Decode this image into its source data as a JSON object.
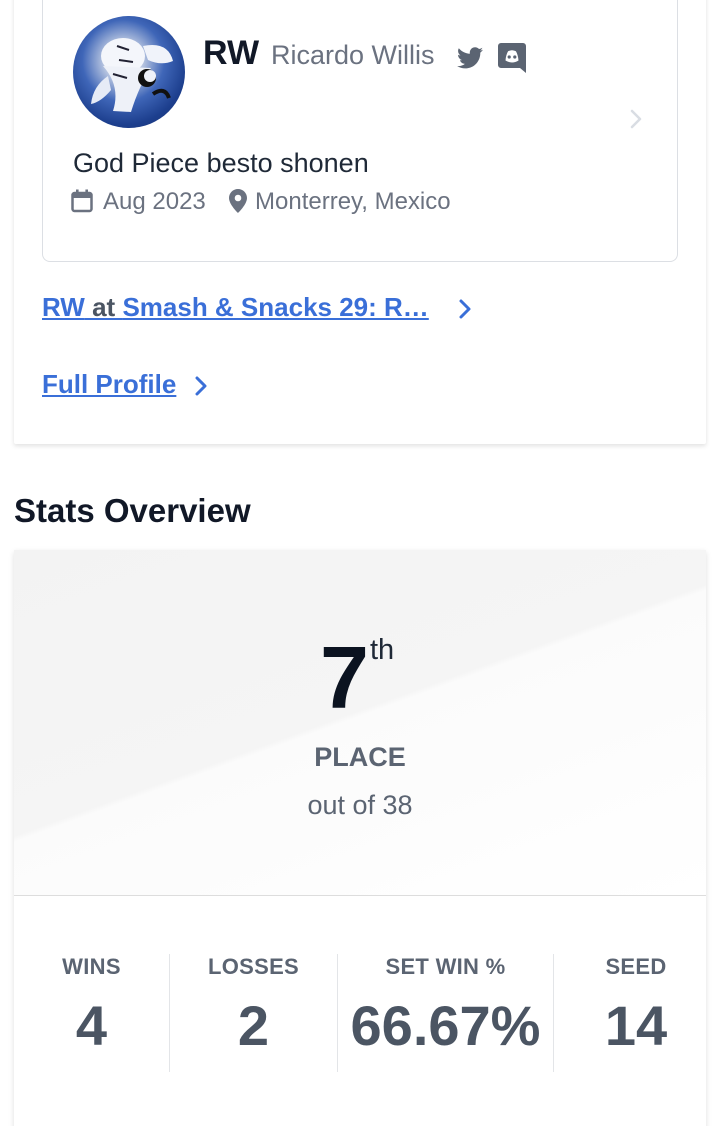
{
  "profile": {
    "gamer_tag": "RW",
    "real_name": "Ricardo Willis",
    "bio": "God Piece besto shonen",
    "joined": "Aug 2023",
    "location": "Monterrey, Mexico",
    "icons": [
      "twitter-icon",
      "discord-icon",
      "calendar-icon",
      "location-pin-icon",
      "chevron-right-icon"
    ]
  },
  "event_link": {
    "player": "RW",
    "connector": " at ",
    "event": "Smash & Snacks 29: R…"
  },
  "full_profile_label": "Full Profile",
  "stats": {
    "section_title": "Stats Overview",
    "place": "7",
    "place_suffix": "th",
    "place_label": "PLACE",
    "out_of": "out of 38",
    "items": [
      {
        "label": "WINS",
        "value": "4"
      },
      {
        "label": "LOSSES",
        "value": "2"
      },
      {
        "label": "SET WIN %",
        "value": "66.67%"
      },
      {
        "label": "SEED",
        "value": "14"
      }
    ]
  },
  "colors": {
    "link": "#3a6fd8",
    "text_dark": "#111827",
    "text_muted": "#6b7280"
  }
}
